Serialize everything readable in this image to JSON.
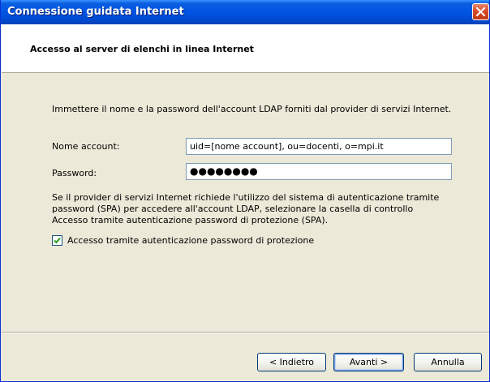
{
  "window": {
    "title": "Connessione guidata Internet"
  },
  "header": {
    "title": "Accesso al server di elenchi in linea Internet"
  },
  "form": {
    "intro": "Immettere il nome e la password dell'account LDAP forniti dal provider di servizi Internet.",
    "account_label": "Nome account:",
    "account_value": "uid=[nome account], ou=docenti, o=mpi.it",
    "password_label": "Password:",
    "password_mask": "●●●●●●●●",
    "spa_text_line1": "Se il provider di servizi Internet richiede l'utilizzo del sistema di autenticazione tramite",
    "spa_text_line2": "password (SPA) per accedere all'account LDAP, selezionare la casella di controllo",
    "spa_text_line3": "Accesso tramite autenticazione password di protezione (SPA).",
    "spa_checkbox_label": "Accesso tramite autenticazione password di protezione",
    "spa_checked": true
  },
  "buttons": {
    "back": "< Indietro",
    "next": "Avanti >",
    "cancel": "Annulla"
  },
  "colors": {
    "titlebar": "#0054e3",
    "dialog_bg": "#ece9d8",
    "checkmark": "#21a121"
  }
}
